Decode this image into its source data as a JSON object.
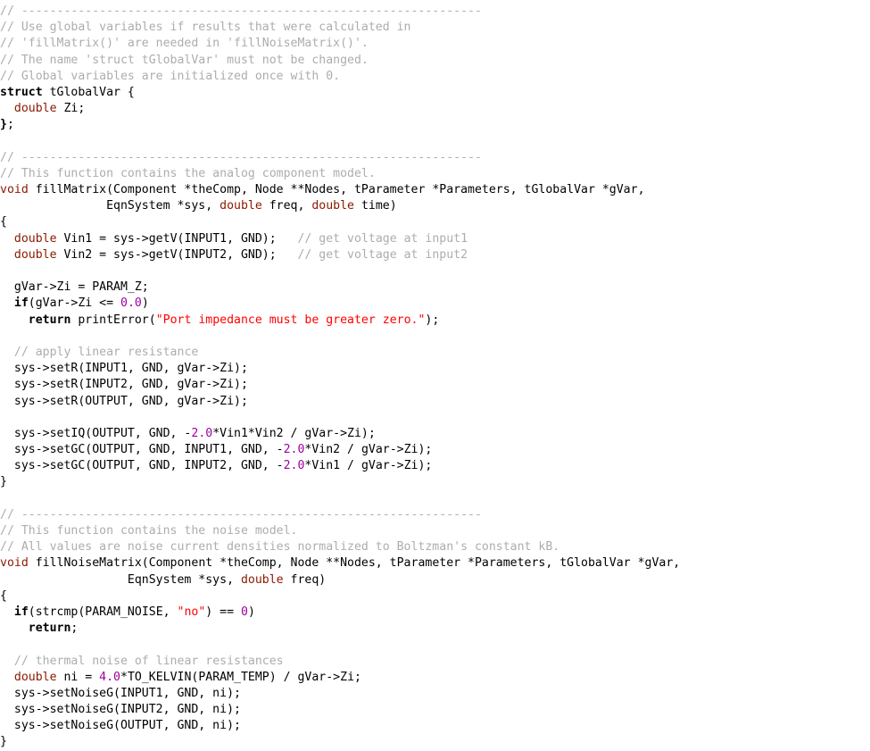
{
  "editor": {
    "language": "C++",
    "background_color": "#ffffff",
    "colors": {
      "plain": "#000000",
      "comment": "#adadad",
      "keyword": "#8b1a00",
      "keyword_bold": "#000000",
      "string": "#ff0000",
      "number": "#a000a0"
    },
    "lines": [
      [
        {
          "t": "comment",
          "v": "// -----------------------------------------------------------------"
        }
      ],
      [
        {
          "t": "comment",
          "v": "// Use global variables if results that were calculated in"
        }
      ],
      [
        {
          "t": "comment",
          "v": "// 'fillMatrix()' are needed in 'fillNoiseMatrix()'."
        }
      ],
      [
        {
          "t": "comment",
          "v": "// The name 'struct tGlobalVar' must not be changed."
        }
      ],
      [
        {
          "t": "comment",
          "v": "// Global variables are initialized once with 0."
        }
      ],
      [
        {
          "t": "kwbold",
          "v": "struct"
        },
        {
          "t": "plain",
          "v": " tGlobalVar {"
        }
      ],
      [
        {
          "t": "plain",
          "v": "  "
        },
        {
          "t": "keyword",
          "v": "double"
        },
        {
          "t": "plain",
          "v": " Zi;"
        }
      ],
      [
        {
          "t": "kwbold",
          "v": "}"
        },
        {
          "t": "plain",
          "v": ";"
        }
      ],
      [
        {
          "t": "plain",
          "v": ""
        }
      ],
      [
        {
          "t": "comment",
          "v": "// -----------------------------------------------------------------"
        }
      ],
      [
        {
          "t": "comment",
          "v": "// This function contains the analog component model."
        }
      ],
      [
        {
          "t": "keyword",
          "v": "void"
        },
        {
          "t": "plain",
          "v": " fillMatrix(Component *theComp, Node **Nodes, tParameter *Parameters, tGlobalVar *gVar,"
        }
      ],
      [
        {
          "t": "plain",
          "v": "               EqnSystem *sys, "
        },
        {
          "t": "keyword",
          "v": "double"
        },
        {
          "t": "plain",
          "v": " freq, "
        },
        {
          "t": "keyword",
          "v": "double"
        },
        {
          "t": "plain",
          "v": " time)"
        }
      ],
      [
        {
          "t": "plain",
          "v": "{"
        }
      ],
      [
        {
          "t": "plain",
          "v": "  "
        },
        {
          "t": "keyword",
          "v": "double"
        },
        {
          "t": "plain",
          "v": " Vin1 = sys->getV(INPUT1, GND);   "
        },
        {
          "t": "comment",
          "v": "// get voltage at input1"
        }
      ],
      [
        {
          "t": "plain",
          "v": "  "
        },
        {
          "t": "keyword",
          "v": "double"
        },
        {
          "t": "plain",
          "v": " Vin2 = sys->getV(INPUT2, GND);   "
        },
        {
          "t": "comment",
          "v": "// get voltage at input2"
        }
      ],
      [
        {
          "t": "plain",
          "v": ""
        }
      ],
      [
        {
          "t": "plain",
          "v": "  gVar->Zi = PARAM_Z;"
        }
      ],
      [
        {
          "t": "plain",
          "v": "  "
        },
        {
          "t": "kwbold",
          "v": "if"
        },
        {
          "t": "plain",
          "v": "(gVar->Zi <= "
        },
        {
          "t": "number",
          "v": "0.0"
        },
        {
          "t": "plain",
          "v": ")"
        }
      ],
      [
        {
          "t": "plain",
          "v": "    "
        },
        {
          "t": "kwbold",
          "v": "return"
        },
        {
          "t": "plain",
          "v": " printError("
        },
        {
          "t": "string",
          "v": "\"Port impedance must be greater zero.\""
        },
        {
          "t": "plain",
          "v": ");"
        }
      ],
      [
        {
          "t": "plain",
          "v": ""
        }
      ],
      [
        {
          "t": "plain",
          "v": "  "
        },
        {
          "t": "comment",
          "v": "// apply linear resistance"
        }
      ],
      [
        {
          "t": "plain",
          "v": "  sys->setR(INPUT1, GND, gVar->Zi);"
        }
      ],
      [
        {
          "t": "plain",
          "v": "  sys->setR(INPUT2, GND, gVar->Zi);"
        }
      ],
      [
        {
          "t": "plain",
          "v": "  sys->setR(OUTPUT, GND, gVar->Zi);"
        }
      ],
      [
        {
          "t": "plain",
          "v": ""
        }
      ],
      [
        {
          "t": "plain",
          "v": "  sys->setIQ(OUTPUT, GND, -"
        },
        {
          "t": "number",
          "v": "2.0"
        },
        {
          "t": "plain",
          "v": "*Vin1*Vin2 / gVar->Zi);"
        }
      ],
      [
        {
          "t": "plain",
          "v": "  sys->setGC(OUTPUT, GND, INPUT1, GND, -"
        },
        {
          "t": "number",
          "v": "2.0"
        },
        {
          "t": "plain",
          "v": "*Vin2 / gVar->Zi);"
        }
      ],
      [
        {
          "t": "plain",
          "v": "  sys->setGC(OUTPUT, GND, INPUT2, GND, -"
        },
        {
          "t": "number",
          "v": "2.0"
        },
        {
          "t": "plain",
          "v": "*Vin1 / gVar->Zi);"
        }
      ],
      [
        {
          "t": "plain",
          "v": "}"
        }
      ],
      [
        {
          "t": "plain",
          "v": ""
        }
      ],
      [
        {
          "t": "comment",
          "v": "// -----------------------------------------------------------------"
        }
      ],
      [
        {
          "t": "comment",
          "v": "// This function contains the noise model."
        }
      ],
      [
        {
          "t": "comment",
          "v": "// All values are noise current densities normalized to Boltzman's constant kB."
        }
      ],
      [
        {
          "t": "keyword",
          "v": "void"
        },
        {
          "t": "plain",
          "v": " fillNoiseMatrix(Component *theComp, Node **Nodes, tParameter *Parameters, tGlobalVar *gVar,"
        }
      ],
      [
        {
          "t": "plain",
          "v": "                  EqnSystem *sys, "
        },
        {
          "t": "keyword",
          "v": "double"
        },
        {
          "t": "plain",
          "v": " freq)"
        }
      ],
      [
        {
          "t": "plain",
          "v": "{"
        }
      ],
      [
        {
          "t": "plain",
          "v": "  "
        },
        {
          "t": "kwbold",
          "v": "if"
        },
        {
          "t": "plain",
          "v": "(strcmp(PARAM_NOISE, "
        },
        {
          "t": "string",
          "v": "\"no\""
        },
        {
          "t": "plain",
          "v": ") == "
        },
        {
          "t": "number",
          "v": "0"
        },
        {
          "t": "plain",
          "v": ")"
        }
      ],
      [
        {
          "t": "plain",
          "v": "    "
        },
        {
          "t": "kwbold",
          "v": "return"
        },
        {
          "t": "plain",
          "v": ";"
        }
      ],
      [
        {
          "t": "plain",
          "v": ""
        }
      ],
      [
        {
          "t": "plain",
          "v": "  "
        },
        {
          "t": "comment",
          "v": "// thermal noise of linear resistances"
        }
      ],
      [
        {
          "t": "plain",
          "v": "  "
        },
        {
          "t": "keyword",
          "v": "double"
        },
        {
          "t": "plain",
          "v": " ni = "
        },
        {
          "t": "number",
          "v": "4.0"
        },
        {
          "t": "plain",
          "v": "*TO_KELVIN(PARAM_TEMP) / gVar->Zi;"
        }
      ],
      [
        {
          "t": "plain",
          "v": "  sys->setNoiseG(INPUT1, GND, ni);"
        }
      ],
      [
        {
          "t": "plain",
          "v": "  sys->setNoiseG(INPUT2, GND, ni);"
        }
      ],
      [
        {
          "t": "plain",
          "v": "  sys->setNoiseG(OUTPUT, GND, ni);"
        }
      ],
      [
        {
          "t": "plain",
          "v": "}"
        }
      ]
    ]
  }
}
